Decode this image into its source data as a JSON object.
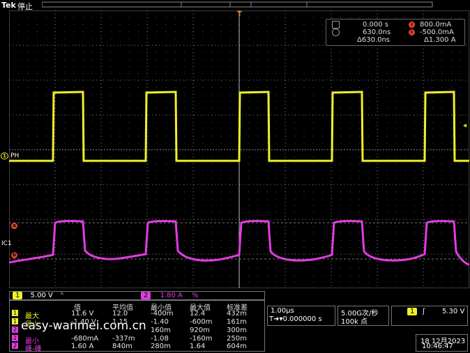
{
  "header": {
    "brand": "Tek",
    "status": "停止"
  },
  "cursors": {
    "t1": "0.000 s",
    "t2": "630.0ns",
    "dt": "Δ630.0ns",
    "a_icon": "a",
    "b_icon": "b",
    "a_val": "800.0mA",
    "b_val": "-500.0mA",
    "dv": "Δ1.300 A"
  },
  "channels": {
    "ch1_num": "1",
    "ch1_scale": "5.00 V",
    "ch1_bw": "ʱ",
    "ch1_label": "PH",
    "ch1_color": "#f0f02a",
    "ch2_num": "2",
    "ch2_scale": "1.80 A",
    "ch2_coupling": "%",
    "ch2_label": "IC1",
    "ch2_color": "#e23ce0",
    "ref_a": "a",
    "ref_b": "b"
  },
  "measurements": {
    "headers": [
      "值",
      "平均值",
      "最小值",
      "最大值",
      "标准差"
    ],
    "rows": [
      {
        "src": "1",
        "name": "最大",
        "color": "#f0f02a",
        "values": [
          "11.6 V",
          "12.0",
          "-400m",
          "12.4",
          "432m"
        ]
      },
      {
        "src": "1",
        "name": "最小",
        "color": "#f0f02a",
        "values": [
          "-1.40 V",
          "1.15",
          "-1.40",
          "-600m",
          "161m"
        ]
      },
      {
        "src": "2",
        "name": "",
        "color": "#e23ce0",
        "values": [
          "",
          "",
          "160m",
          "920m",
          "300m"
        ]
      },
      {
        "src": "2",
        "name": "最小",
        "color": "#e23ce0",
        "values": [
          "-680mA",
          "-337m",
          "-1.08",
          "-160m",
          "250m"
        ]
      },
      {
        "src": "2",
        "name": "峰-峰",
        "color": "#e23ce0",
        "values": [
          "1.60 A",
          "840m",
          "280m",
          "1.64",
          "604m"
        ]
      }
    ]
  },
  "timebase": {
    "scale": "1.00µs",
    "position": "T➜▾0.000000 s"
  },
  "acquisition": {
    "rate": "5.00G次/秒",
    "points": "100k 点"
  },
  "trigger": {
    "src": "1",
    "slope": "ʃ",
    "level": "5.30 V"
  },
  "datetime": {
    "date": "18 12月2023",
    "time": "10:46:47"
  },
  "watermark": "easy-wanmei.com.cn"
}
